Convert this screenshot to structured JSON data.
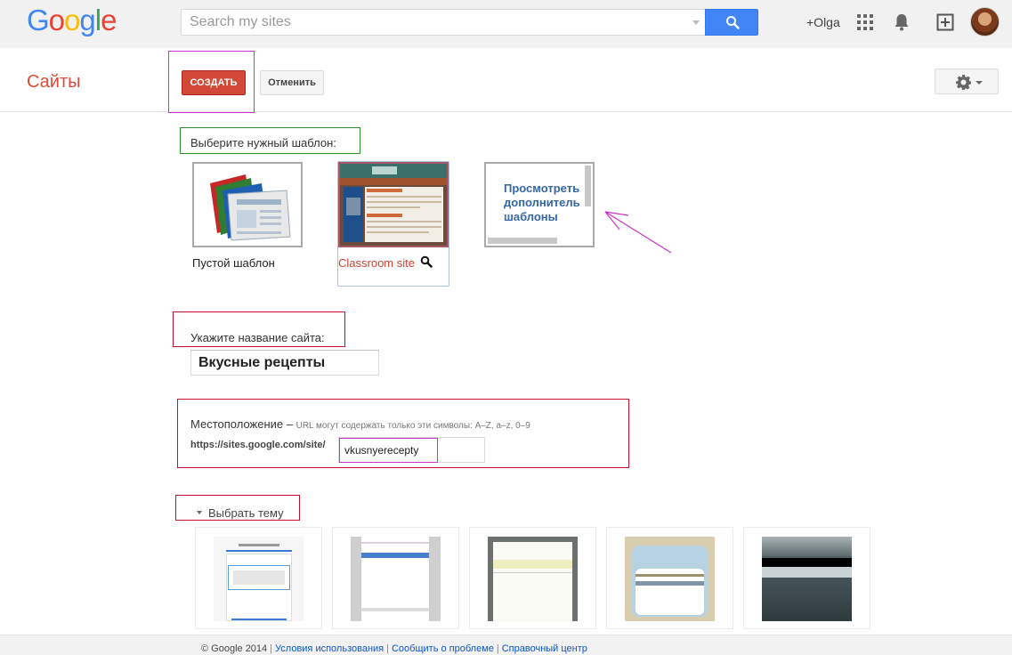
{
  "topbar": {
    "logo": [
      "G",
      "o",
      "o",
      "g",
      "l",
      "e"
    ],
    "logo_colors": [
      "#4285f4",
      "#ea4335",
      "#fbbc05",
      "#4285f4",
      "#34a853",
      "#ea4335"
    ],
    "search_placeholder": "Search my sites",
    "user_label": "+Olga"
  },
  "header": {
    "title": "Сайты",
    "create_label": "СОЗДАТЬ",
    "cancel_label": "Отменить"
  },
  "templates": {
    "heading": "Выберите нужный шаблон:",
    "items": [
      {
        "label": "Пустой шаблон",
        "icon": "blank-template-icon"
      },
      {
        "label": "Classroom site",
        "icon": "magnifier-icon"
      },
      {
        "label": "Просмотреть дополнительные шаблоны",
        "icon": "more-templates-icon"
      }
    ],
    "more_lines": [
      "Просмотреть",
      "дополнитель",
      "шаблоны"
    ],
    "selected": "Classroom site"
  },
  "site_name": {
    "label": "Укажите название сайта:",
    "value": "Вкусные рецепты"
  },
  "location": {
    "label": "Местоположение –",
    "hint": "URL могут содержать только эти символы: A–Z, a–z, 0–9",
    "prefix": "https://sites.google.com/site/",
    "value": "vkusnyerecepty"
  },
  "theme": {
    "toggle_label": "Выбрать тему"
  },
  "footer": {
    "copyright": "© Google 2014",
    "links": [
      "Условия использования",
      "Сообщить о проблеме",
      "Справочный центр"
    ]
  },
  "colors": {
    "accent_red": "#d14836",
    "title_red": "#dd4b39",
    "search_blue": "#4285f4",
    "annotation_purple": "#cc33cc",
    "annotation_green": "#2d8a2d",
    "annotation_red": "#c8102e"
  }
}
